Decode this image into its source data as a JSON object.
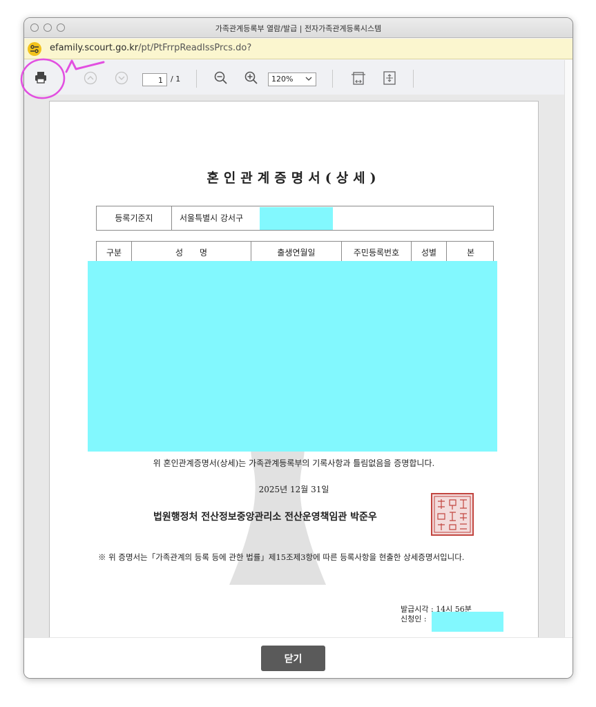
{
  "window": {
    "title": "가족관계등록부 열람/발급 | 전자가족관계등록시스템"
  },
  "urlbar": {
    "domain": "efamily.scourt.go.kr",
    "path": "/pt/PtFrrpReadIssPrcs.do?",
    "site_icon": "site-info-icon"
  },
  "toolbar": {
    "icons": [
      "print-icon",
      "prev-page-icon",
      "next-page-icon",
      "zoom-out-icon",
      "zoom-in-icon",
      "fit-width-icon",
      "fit-page-icon"
    ],
    "page_current": "1",
    "page_total": "/ 1",
    "zoom_value": "120%"
  },
  "document": {
    "title": "혼인관계증명서(상세)",
    "reg_label": "등록기준지",
    "reg_value": "서울특별시 강서구",
    "table_headers": [
      "구분",
      "성　　명",
      "출생연월일",
      "주민등록번호",
      "성별",
      "본"
    ],
    "certification": "위 혼인관계증명서(상세)는 가족관계등록부의 기록사항과 틀림없음을 증명합니다.",
    "date": "2025년 12월 31일",
    "issuer": "법원행정처 전산정보중앙관리소 전산운영책임관 박준우",
    "seal_text": "전산정보중앙관리소전산운영책임관인",
    "note": "※ 위 증명서는「가족관계의 등록 등에 관한 법률」제15조제3항에 따른 등록사항을 현출한 상세증명서입니다.",
    "issue_time": "발급시각 : 14시 56분",
    "applicant": "신청인 :"
  },
  "footer": {
    "close_label": "닫기"
  },
  "colors": {
    "redaction": "#82f8fe",
    "annotation": "#e24fe0",
    "seal": "#c2453f",
    "url_bar": "#fbf6cf"
  }
}
